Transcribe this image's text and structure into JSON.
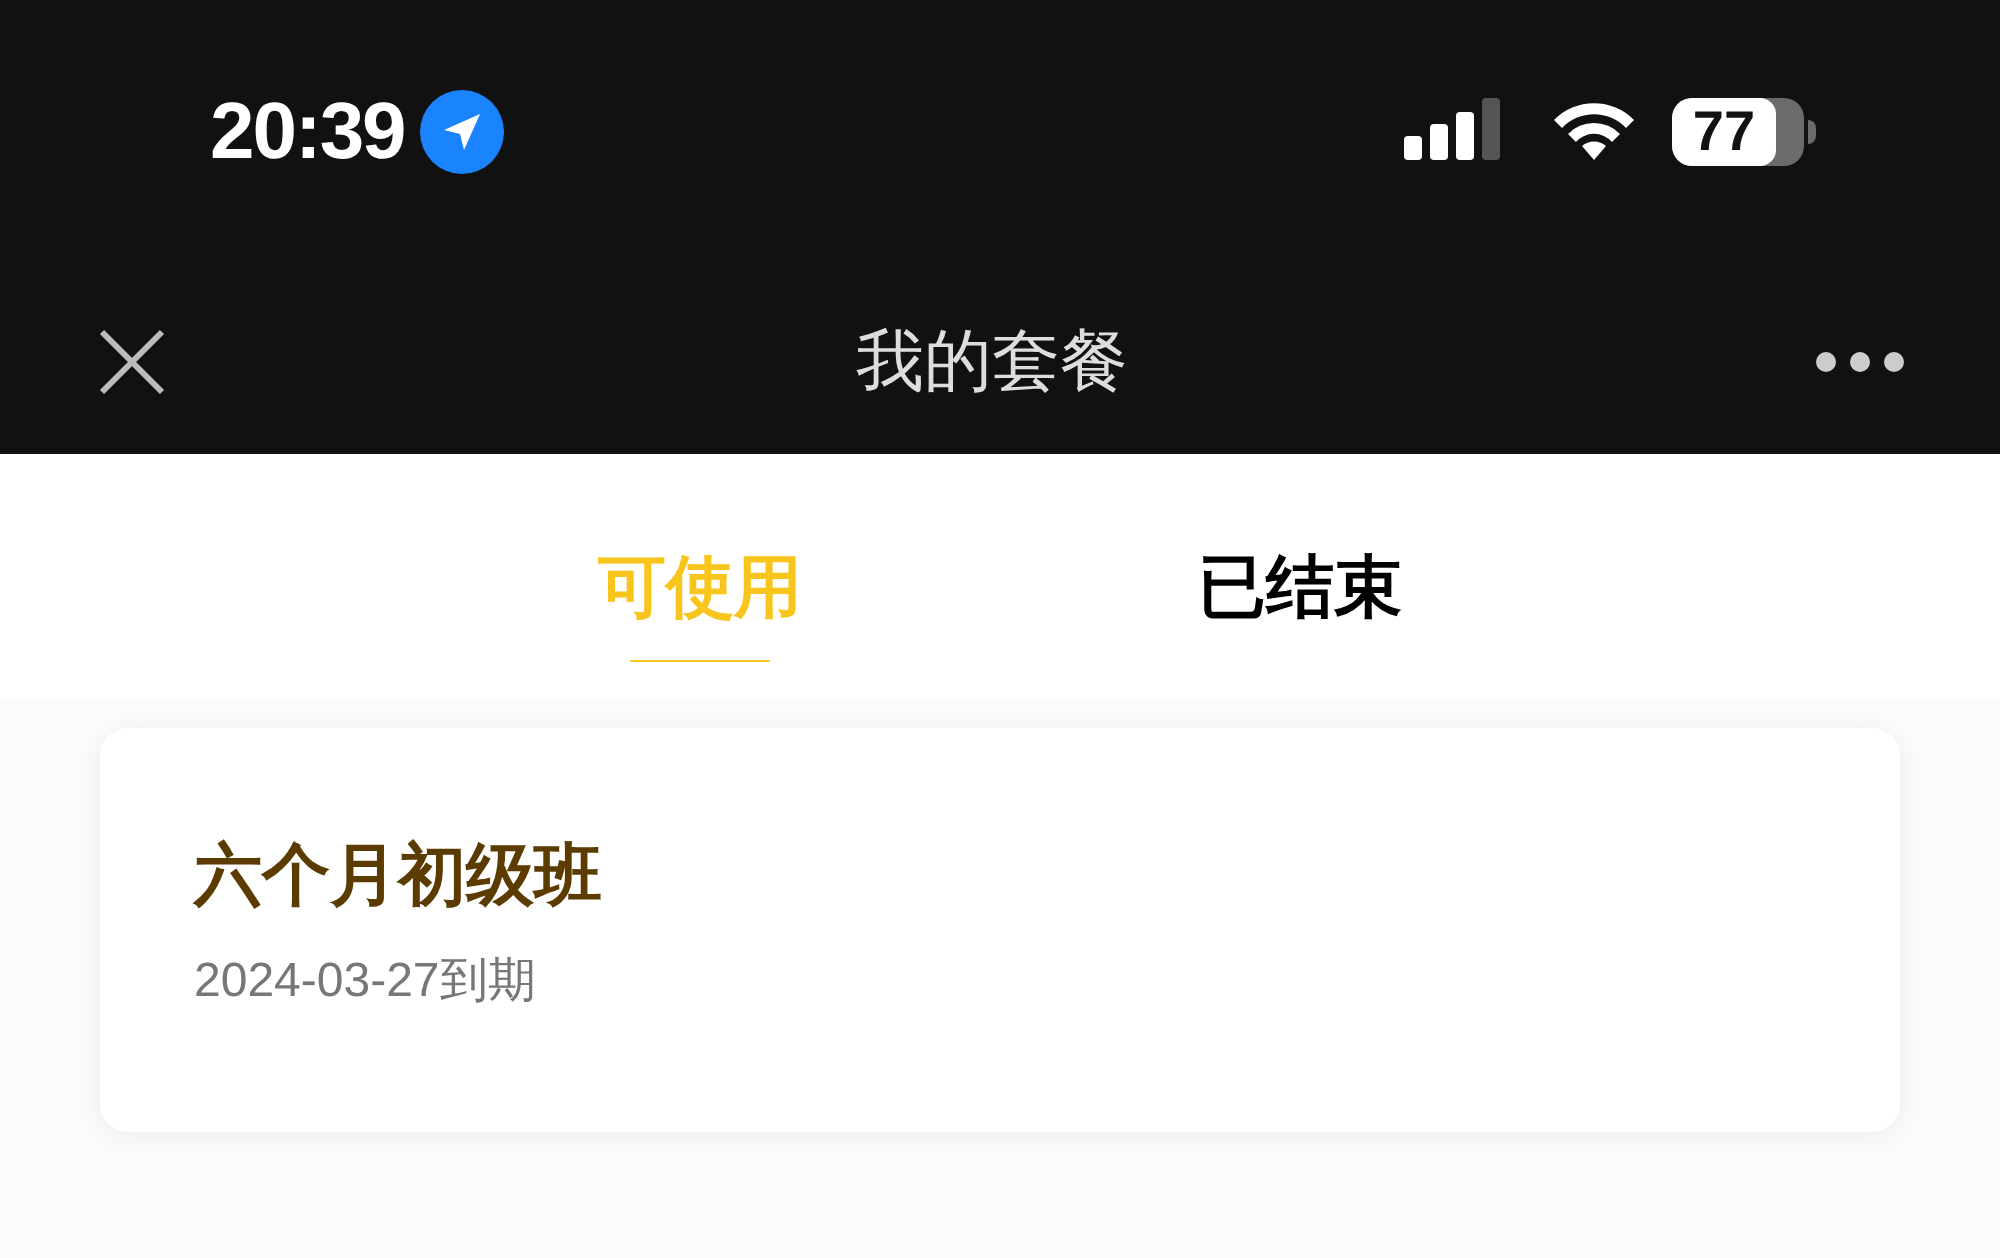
{
  "status_bar": {
    "time": "20:39",
    "battery": "77"
  },
  "nav_bar": {
    "title": "我的套餐"
  },
  "tabs": [
    {
      "label": "可使用",
      "selected": true
    },
    {
      "label": "已结束",
      "selected": false
    }
  ],
  "packages": [
    {
      "name": "六个月初级班",
      "expiry": "2024-03-27到期"
    }
  ]
}
